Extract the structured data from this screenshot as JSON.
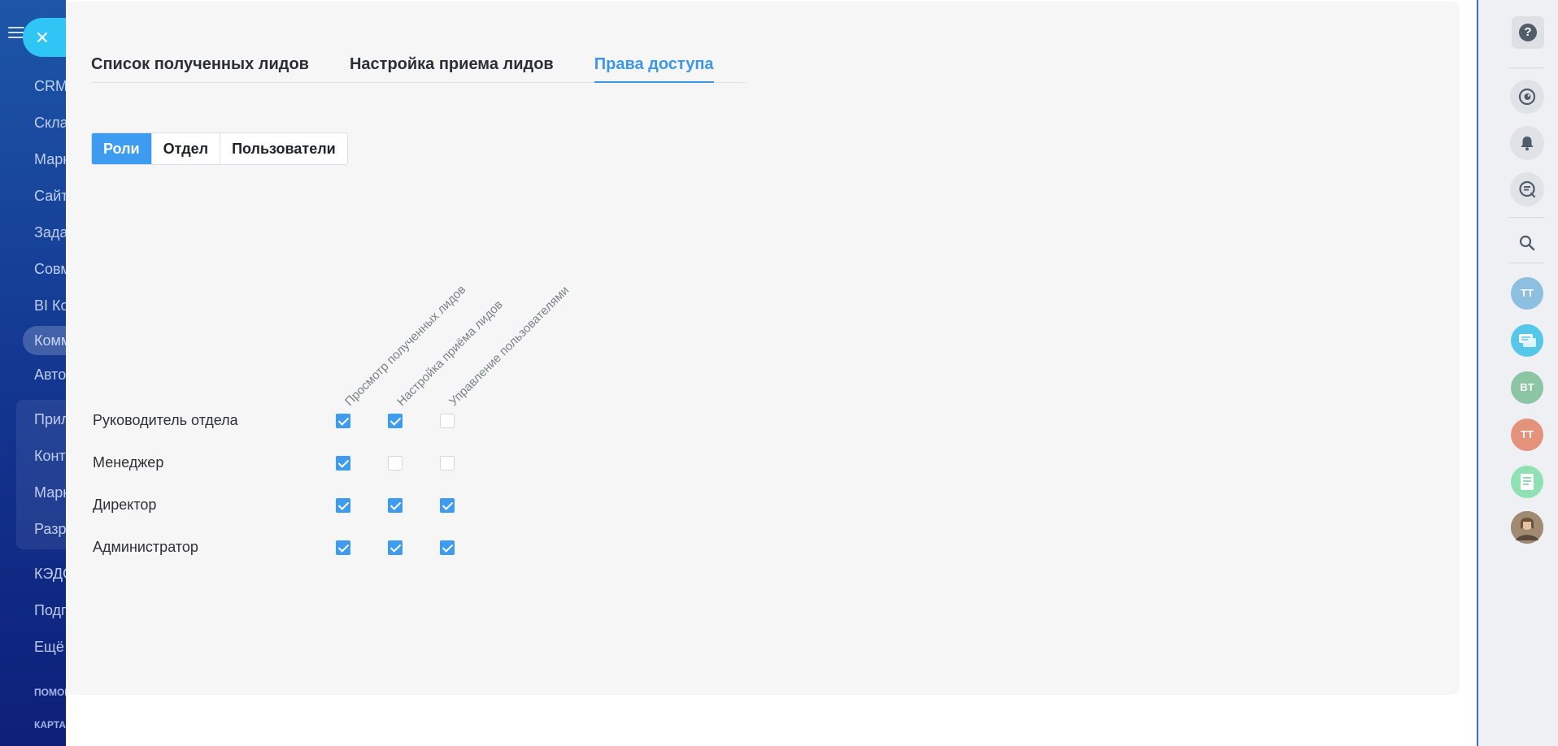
{
  "left_menu": {
    "items": [
      {
        "label": "CRM"
      },
      {
        "label": "Склад"
      },
      {
        "label": "Маркетинг"
      },
      {
        "label": "Сайты"
      },
      {
        "label": "Задачи"
      },
      {
        "label": "Совместная"
      },
      {
        "label": "BI Конструктор"
      },
      {
        "label": "Коммуникации",
        "active": true
      },
      {
        "label": "Автоматизация"
      }
    ],
    "group_items": [
      {
        "label": "Приложения"
      },
      {
        "label": "Контакт-центр"
      },
      {
        "label": "Маркет"
      },
      {
        "label": "Разработчикам"
      }
    ],
    "bottom_items": [
      {
        "label": "КЭДО"
      },
      {
        "label": "Подписка"
      },
      {
        "label": "Ещё"
      }
    ],
    "footer": [
      "ПОМОЩЬ",
      "КАРТА"
    ]
  },
  "tabs": [
    {
      "label": "Список полученных лидов",
      "active": false
    },
    {
      "label": "Настройка приема лидов",
      "active": false
    },
    {
      "label": "Права доступа",
      "active": true
    }
  ],
  "segments": [
    {
      "label": "Роли",
      "active": true
    },
    {
      "label": "Отдел",
      "active": false
    },
    {
      "label": "Пользователи",
      "active": false
    }
  ],
  "permissions": {
    "columns": [
      "Просмотр полученных лидов",
      "Настройка приёма лидов",
      "Управление пользователями"
    ],
    "rows": [
      {
        "role": "Руководитель отдела",
        "values": [
          true,
          true,
          false
        ]
      },
      {
        "role": "Менеджер",
        "values": [
          true,
          false,
          false
        ]
      },
      {
        "role": "Директор",
        "values": [
          true,
          true,
          true
        ]
      },
      {
        "role": "Администратор",
        "values": [
          true,
          true,
          true
        ]
      }
    ]
  },
  "right_bar": {
    "help_label": "?",
    "icons": [
      "copilot-icon",
      "bell-icon",
      "chat-search-icon",
      "search-icon"
    ],
    "avatars": [
      {
        "initials": "TT",
        "color": "#8cbfe0"
      },
      {
        "initials": "",
        "color": "#55c7e8",
        "icon": "chat-bubbles-icon"
      },
      {
        "initials": "BT",
        "color": "#8bc5a3"
      },
      {
        "initials": "TT",
        "color": "#e5927d"
      },
      {
        "initials": "",
        "color": "#8fe0b3",
        "icon": "document-icon"
      },
      {
        "initials": "",
        "color": "#7c6a58",
        "icon": "user-photo"
      }
    ]
  },
  "colors": {
    "accent": "#3d97e8",
    "checkbox": "#3d9cf0",
    "close_button": "#2fc6f6",
    "menu_bg": "#12348f"
  }
}
